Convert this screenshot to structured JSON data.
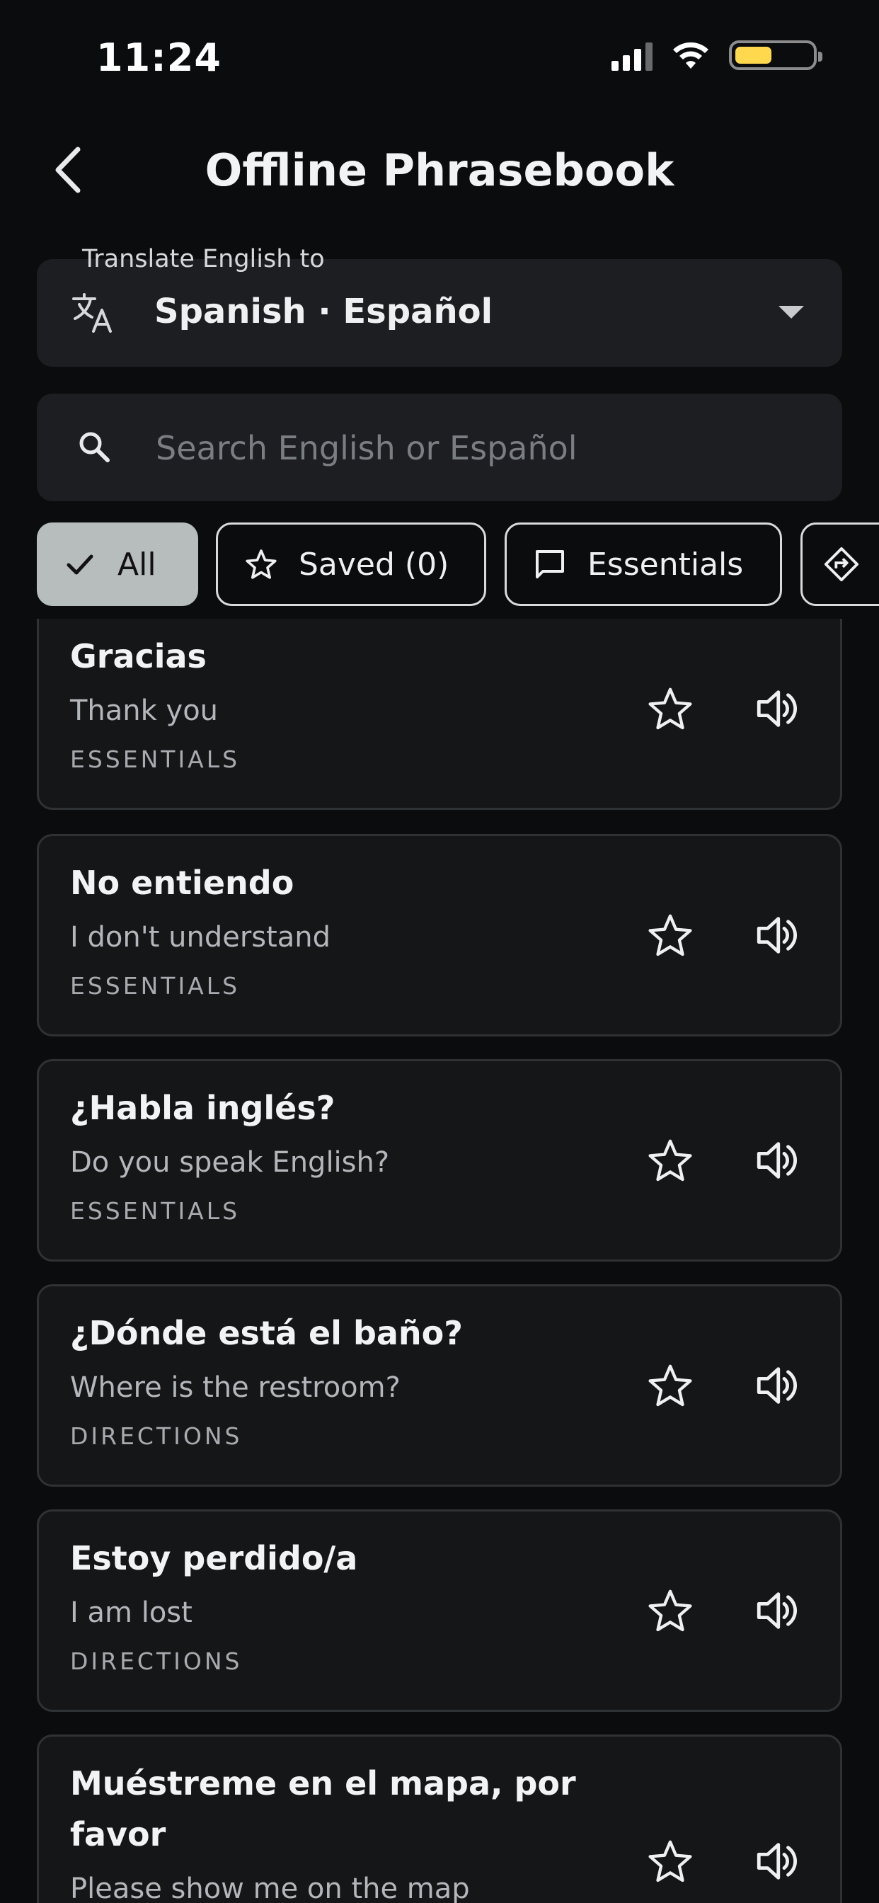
{
  "status_bar": {
    "time": "11:24"
  },
  "header": {
    "title": "Offline Phrasebook",
    "back_icon": "chevron-left-icon"
  },
  "language_select": {
    "label": "Translate English to",
    "value": "Spanish · Español",
    "icon": "translate-icon"
  },
  "search": {
    "placeholder": "Search English or Español",
    "value": ""
  },
  "filters": [
    {
      "label": "All",
      "icon": "check-icon",
      "selected": true
    },
    {
      "label": "Saved (0)",
      "icon": "star-outline-icon",
      "selected": false
    },
    {
      "label": "Essentials",
      "icon": "chat-bubble-icon",
      "selected": false
    },
    {
      "label": "",
      "icon": "directions-icon",
      "selected": false
    }
  ],
  "phrases": [
    {
      "spanish": "Gracias",
      "english": "Thank you",
      "category": "ESSENTIALS"
    },
    {
      "spanish": "No entiendo",
      "english": "I don't understand",
      "category": "ESSENTIALS"
    },
    {
      "spanish": "¿Habla inglés?",
      "english": "Do you speak English?",
      "category": "ESSENTIALS"
    },
    {
      "spanish": "¿Dónde está el baño?",
      "english": "Where is the restroom?",
      "category": "DIRECTIONS"
    },
    {
      "spanish": "Estoy perdido/a",
      "english": "I am lost",
      "category": "DIRECTIONS"
    },
    {
      "spanish": "Muéstreme en el mapa, por favor",
      "english": "Please show me on the map",
      "category": ""
    }
  ],
  "colors": {
    "battery": "#ffd84d",
    "selected_chip": "#b7bcbd",
    "card_border": "#2f3235"
  }
}
